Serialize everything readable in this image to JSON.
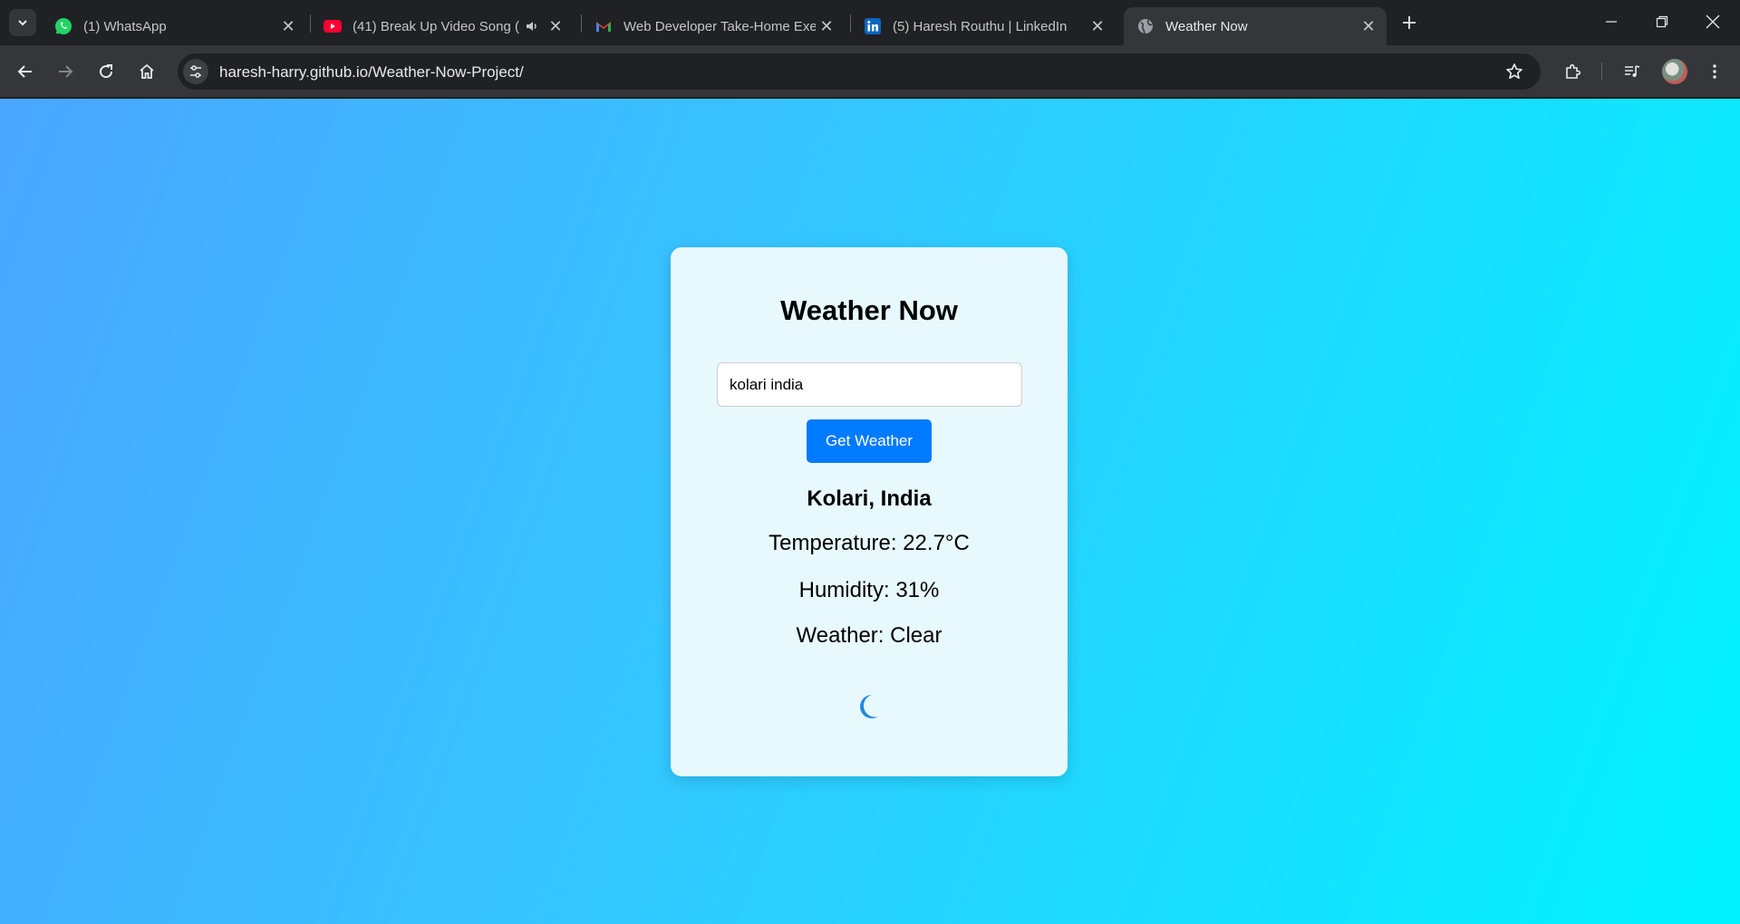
{
  "browser": {
    "tabs": [
      {
        "title": "(1) WhatsApp",
        "icon": "whatsapp-icon"
      },
      {
        "title": "(41) Break Up Video Song (",
        "icon": "youtube-icon"
      },
      {
        "title": "Web Developer Take-Home Exe",
        "icon": "gmail-icon"
      },
      {
        "title": "(5) Haresh Routhu | LinkedIn",
        "icon": "linkedin-icon"
      },
      {
        "title": "Weather Now",
        "icon": "globe-icon",
        "active": true
      }
    ],
    "url": "haresh-harry.github.io/Weather-Now-Project/"
  },
  "app": {
    "title": "Weather Now",
    "search": {
      "value": "kolari india"
    },
    "button_label": "Get Weather",
    "location": "Kolari, India",
    "temperature": "Temperature: 22.7°C",
    "humidity": "Humidity: 31%",
    "condition": "Weather: Clear",
    "weather_icon": "moon-icon"
  },
  "colors": {
    "accent": "#007bff",
    "card_bg": "#e8f9fd",
    "gradient_start": "#4aa6ff",
    "gradient_end": "#00f4ff"
  }
}
